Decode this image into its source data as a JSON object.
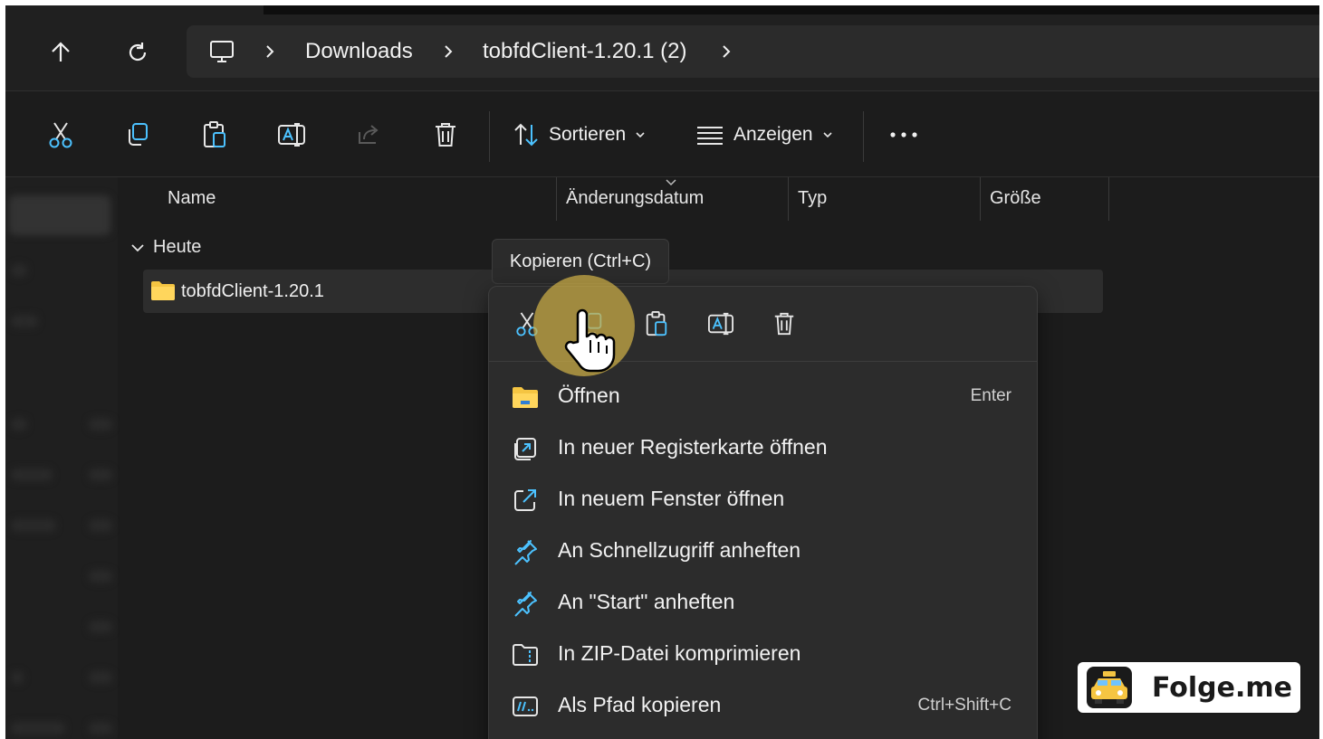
{
  "breadcrumb": {
    "items": [
      "Downloads",
      "tobfdClient-1.20.1 (2)"
    ]
  },
  "toolbar": {
    "sort_label": "Sortieren",
    "view_label": "Anzeigen"
  },
  "columns": [
    "Name",
    "Änderungsdatum",
    "Typ",
    "Größe"
  ],
  "group": {
    "label": "Heute"
  },
  "file_row": {
    "name": "tobfdClient-1.20.1"
  },
  "tooltip": {
    "text": "Kopieren (Ctrl+C)"
  },
  "context_menu": {
    "items": [
      {
        "label": "Öffnen",
        "shortcut": "Enter",
        "icon": "folder-icon"
      },
      {
        "label": "In neuer Registerkarte öffnen",
        "shortcut": "",
        "icon": "new-tab-icon"
      },
      {
        "label": "In neuem Fenster öffnen",
        "shortcut": "",
        "icon": "new-window-icon"
      },
      {
        "label": "An Schnellzugriff anheften",
        "shortcut": "",
        "icon": "pin-icon"
      },
      {
        "label": "An \"Start\" anheften",
        "shortcut": "",
        "icon": "pin-icon"
      },
      {
        "label": "In ZIP-Datei komprimieren",
        "shortcut": "",
        "icon": "zip-icon"
      },
      {
        "label": "Als Pfad kopieren",
        "shortcut": "Ctrl+Shift+C",
        "icon": "copy-path-icon"
      }
    ]
  },
  "watermark": {
    "text": "Folge.me"
  },
  "colors": {
    "accent_blue": "#4cc2ff",
    "folder_yellow": "#f5c542",
    "cursor_highlight": "#cdaf46"
  }
}
